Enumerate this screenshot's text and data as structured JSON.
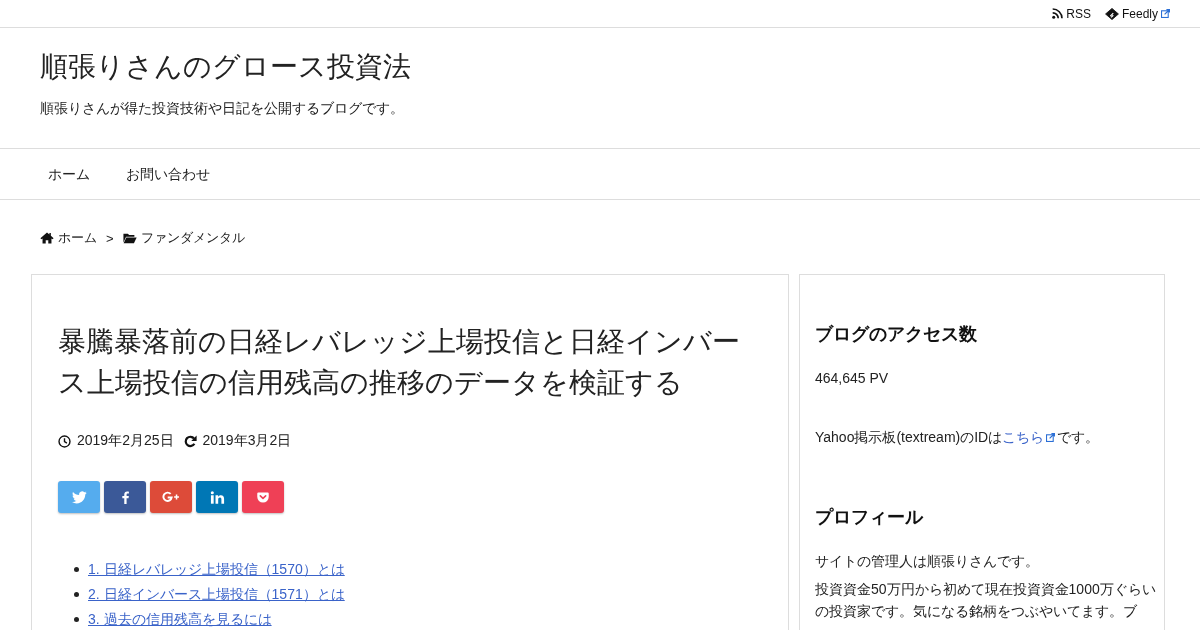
{
  "top_bar": {
    "links": [
      {
        "label": "RSS",
        "kind": "rss",
        "external": false
      },
      {
        "label": "Feedly",
        "kind": "feedly",
        "external": true
      }
    ]
  },
  "header": {
    "site_title": "順張りさんのグロース投資法",
    "tagline": "順張りさんが得た投資技術や日記を公開するブログです。"
  },
  "nav": {
    "items": [
      {
        "label": "ホーム"
      },
      {
        "label": "お問い合わせ"
      }
    ]
  },
  "breadcrumb": {
    "separator": ">",
    "items": [
      {
        "label": "ホーム",
        "kind": "home"
      },
      {
        "label": "ファンダメンタル",
        "kind": "category"
      }
    ]
  },
  "article": {
    "title": "暴騰暴落前の日経レバレッジ上場投信と日経インバース上場投信の信用残高の推移のデータを検証する",
    "dates": [
      {
        "kind": "published",
        "text": "2019年2月25日"
      },
      {
        "kind": "updated",
        "text": "2019年3月2日"
      }
    ],
    "share_buttons": [
      {
        "kind": "twitter",
        "color": "#55acee"
      },
      {
        "kind": "facebook",
        "color": "#3b5998"
      },
      {
        "kind": "googleplus",
        "color": "#dd4b39"
      },
      {
        "kind": "linkedin",
        "color": "#0077b5"
      },
      {
        "kind": "pocket",
        "color": "#ef4056"
      }
    ],
    "toc": [
      {
        "label": "1. 日経レバレッジ上場投信（1570）とは"
      },
      {
        "label": "2. 日経インバース上場投信（1571）とは"
      },
      {
        "label": "3. 過去の信用残高を見るには"
      }
    ]
  },
  "sidebar": {
    "widgets": [
      {
        "title": "ブログのアクセス数",
        "paragraphs": [
          {
            "text": "464,645 PV"
          }
        ]
      },
      {
        "paragraphs": [
          {
            "text": "Yahoo掲示板(textream)のIDは",
            "link": "こちら",
            "external": true,
            "after": "です。"
          }
        ]
      },
      {
        "title": "プロフィール",
        "paragraphs": [
          {
            "text": "サイトの管理人は順張りさんです。"
          },
          {
            "text": "投資資金50万円から初めて現在投資資金1000万ぐらいの投資家です。気になる銘柄をつぶやいてます。ブ"
          }
        ]
      }
    ]
  }
}
